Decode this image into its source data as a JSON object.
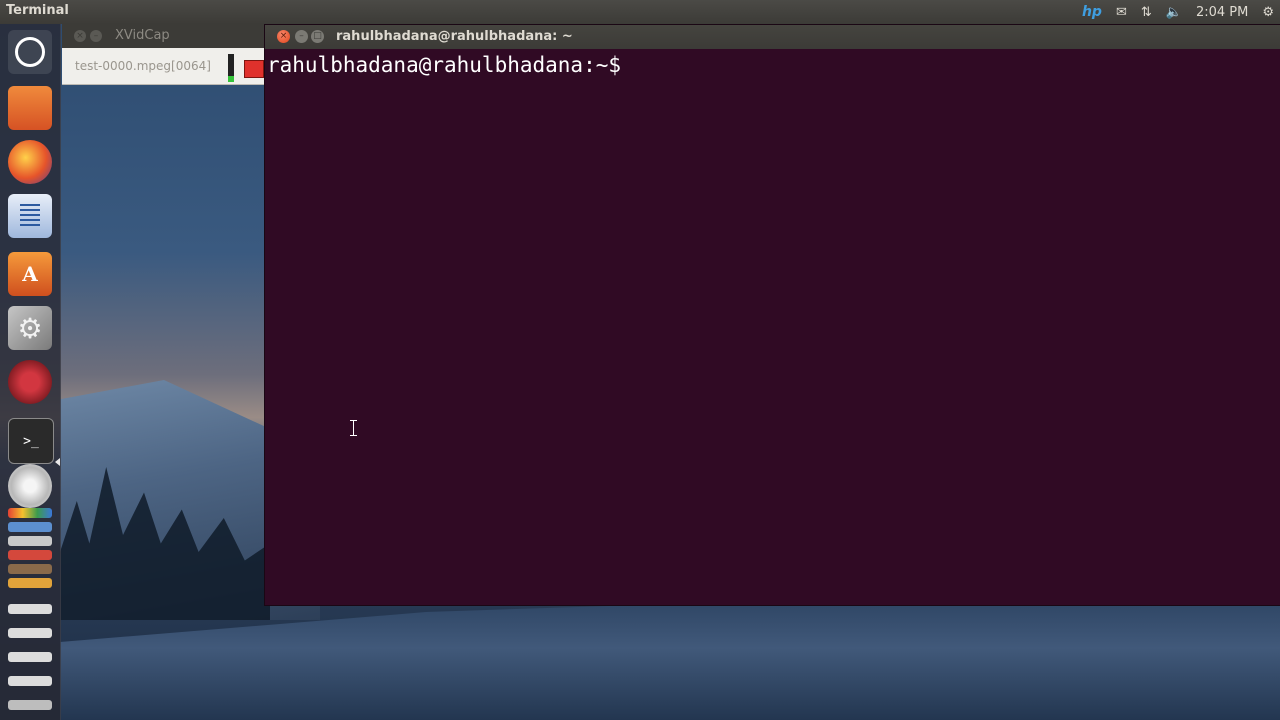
{
  "top_panel": {
    "app_title": "Terminal",
    "indicators": [
      "hp-icon",
      "mail-icon",
      "network-icon",
      "volume-icon",
      "clock",
      "settings-gear-icon"
    ],
    "hp_label": "hp",
    "time": "2:04 PM"
  },
  "launcher": {
    "items": [
      "dash-home-icon",
      "files-icon",
      "firefox-icon",
      "libreoffice-writer-icon",
      "software-center-icon",
      "system-settings-icon",
      "record-app-icon",
      "terminal-icon",
      "dvd-icon",
      "chrome-icon",
      "stacked-app-icons"
    ],
    "terminal_glyph": ">_",
    "software_glyph": "A"
  },
  "xvidcap": {
    "title": "XVidCap",
    "file_label": "test-0000.mpeg[0064]"
  },
  "terminal": {
    "window_title": "rahulbhadana@rahulbhadana: ~",
    "prompt": "rahulbhadana@rahulbhadana:~$"
  },
  "colors": {
    "terminal_bg": "#300a24",
    "panel_bg": "#3c3b37",
    "close_button": "#e0451b",
    "record_red": "#e0312c"
  }
}
